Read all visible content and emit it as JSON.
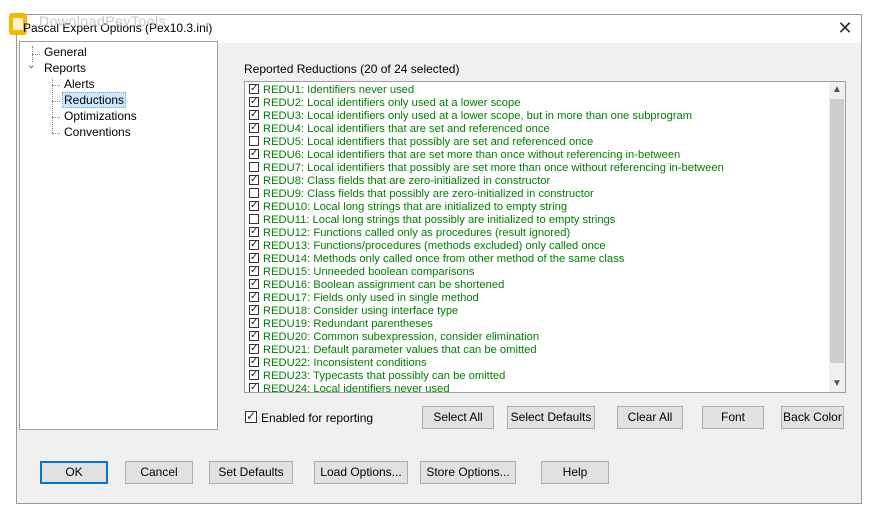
{
  "window": {
    "title": "Pascal Expert Options (Pex10.3.ini)",
    "watermark": "DownloadPeyTools",
    "close_glyph": "✕"
  },
  "tree": {
    "items": [
      {
        "label": "General",
        "level": 0
      },
      {
        "label": "Reports",
        "level": 0,
        "expanded": true
      },
      {
        "label": "Alerts",
        "level": 1
      },
      {
        "label": "Reductions",
        "level": 1,
        "selected": true
      },
      {
        "label": "Optimizations",
        "level": 1
      },
      {
        "label": "Conventions",
        "level": 1
      }
    ]
  },
  "reductions": {
    "heading": "Reported Reductions (20 of 24 selected)",
    "text_color": "#008000",
    "items": [
      {
        "label": "REDU1: Identifiers never used",
        "checked": true
      },
      {
        "label": "REDU2: Local identifiers only used at a lower scope",
        "checked": true
      },
      {
        "label": "REDU3: Local identifiers only used at a lower scope, but in more than one subprogram",
        "checked": true
      },
      {
        "label": "REDU4: Local identifiers that are set and referenced once",
        "checked": true
      },
      {
        "label": "REDU5: Local identifiers that possibly are set and referenced once",
        "checked": false
      },
      {
        "label": "REDU6: Local identifiers that are set more than once without referencing in-between",
        "checked": true
      },
      {
        "label": "REDU7: Local identifiers that possibly are set more than once without referencing in-between",
        "checked": false
      },
      {
        "label": "REDU8: Class fields that are zero-initialized in constructor",
        "checked": true
      },
      {
        "label": "REDU9: Class fields that possibly are zero-initialized in constructor",
        "checked": false
      },
      {
        "label": "REDU10: Local long strings that are initialized to empty string",
        "checked": true
      },
      {
        "label": "REDU11: Local long strings that possibly are initialized to empty strings",
        "checked": false
      },
      {
        "label": "REDU12: Functions called only as procedures (result ignored)",
        "checked": true
      },
      {
        "label": "REDU13: Functions/procedures (methods excluded) only called once",
        "checked": true
      },
      {
        "label": "REDU14: Methods only called once from other method of the same class",
        "checked": true
      },
      {
        "label": "REDU15: Unneeded boolean comparisons",
        "checked": true
      },
      {
        "label": "REDU16: Boolean assignment can be shortened",
        "checked": true
      },
      {
        "label": "REDU17: Fields only used in single method",
        "checked": true
      },
      {
        "label": "REDU18: Consider using interface type",
        "checked": true
      },
      {
        "label": "REDU19: Redundant parentheses",
        "checked": true
      },
      {
        "label": "REDU20: Common subexpression, consider elimination",
        "checked": true
      },
      {
        "label": "REDU21: Default parameter values that can be omitted",
        "checked": true
      },
      {
        "label": "REDU22: Inconsistent conditions",
        "checked": true
      },
      {
        "label": "REDU23: Typecasts that possibly can be omitted",
        "checked": true
      },
      {
        "label": "REDU24: Local identifiers never used",
        "checked": true
      }
    ]
  },
  "enabled_for_reporting": {
    "label": "Enabled for reporting",
    "checked": true
  },
  "list_buttons": {
    "select_all": "Select All",
    "select_defaults": "Select Defaults",
    "clear_all": "Clear All",
    "font": "Font",
    "back_color": "Back Color"
  },
  "dialog_buttons": {
    "ok": "OK",
    "cancel": "Cancel",
    "set_defaults": "Set Defaults",
    "load_options": "Load Options...",
    "store_options": "Store Options...",
    "help": "Help"
  },
  "icons": {
    "scroll_up": "▲",
    "scroll_down": "▼",
    "expander": "⌄"
  }
}
